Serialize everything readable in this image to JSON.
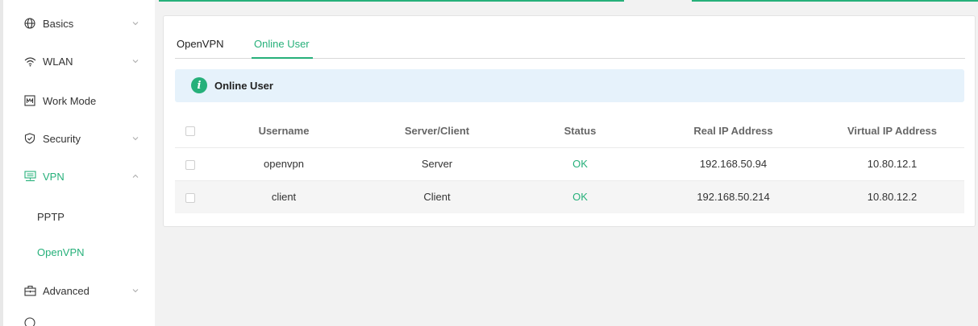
{
  "sidebar": {
    "items": [
      {
        "label": "Basics",
        "icon": "globe-icon",
        "chevron": "down"
      },
      {
        "label": "WLAN",
        "icon": "wifi-icon",
        "chevron": "down"
      },
      {
        "label": "Work Mode",
        "icon": "work-mode-icon",
        "chevron": ""
      },
      {
        "label": "Security",
        "icon": "shield-icon",
        "chevron": "down"
      },
      {
        "label": "VPN",
        "icon": "vpn-icon",
        "chevron": "up"
      },
      {
        "label": "Advanced",
        "icon": "briefcase-icon",
        "chevron": "down"
      }
    ],
    "vpn_sub": [
      {
        "label": "PPTP"
      },
      {
        "label": "OpenVPN"
      }
    ]
  },
  "tabs": [
    {
      "label": "OpenVPN"
    },
    {
      "label": "Online User"
    }
  ],
  "banner": {
    "title": "Online User",
    "icon": "info-icon"
  },
  "table": {
    "headers": [
      "Username",
      "Server/Client",
      "Status",
      "Real IP Address",
      "Virtual IP Address"
    ],
    "rows": [
      {
        "username": "openvpn",
        "role": "Server",
        "status": "OK",
        "real_ip": "192.168.50.94",
        "virtual_ip": "10.80.12.1"
      },
      {
        "username": "client",
        "role": "Client",
        "status": "OK",
        "real_ip": "192.168.50.214",
        "virtual_ip": "10.80.12.2"
      }
    ]
  },
  "colors": {
    "accent": "#26b07a",
    "banner_bg": "#e6f2fb",
    "page_bg": "#f2f2f2"
  }
}
